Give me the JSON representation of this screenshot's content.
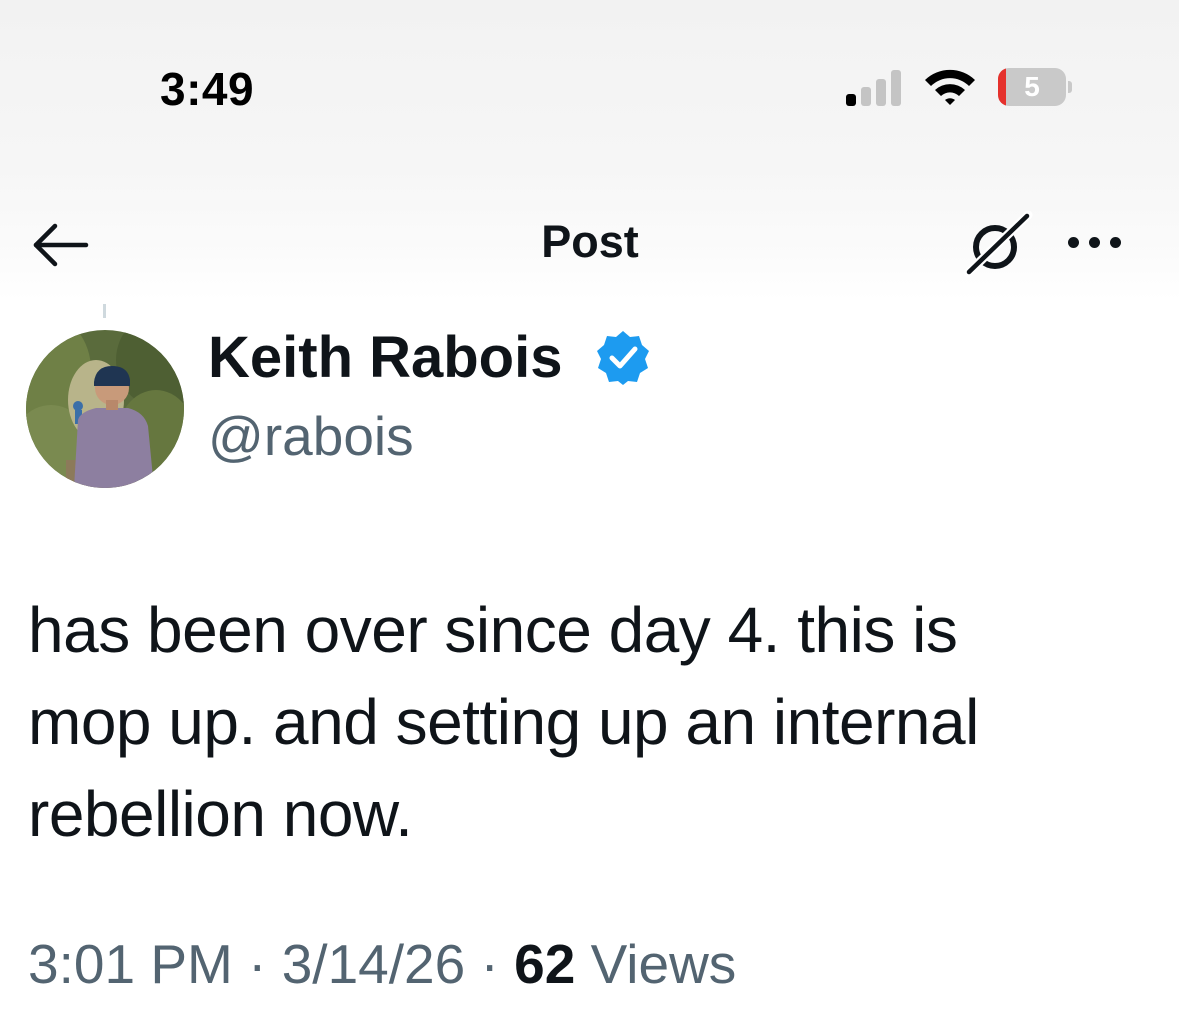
{
  "status_bar": {
    "time": "3:49",
    "battery_level": "5",
    "signal_bars_active": 1,
    "signal_bars_total": 4,
    "battery_fraction": 0.05
  },
  "nav": {
    "title": "Post",
    "back_icon": "arrow-left-icon",
    "grok_icon": "grok-icon",
    "more_icon": "more-horizontal-icon"
  },
  "author": {
    "name": "Keith Rabois",
    "handle": "@rabois",
    "verified": true,
    "verified_icon": "verified-badge-icon"
  },
  "post": {
    "lines": [
      "has been over since day 4.  this is",
      "mop up.  and setting up an internal",
      "rebellion now."
    ]
  },
  "meta": {
    "time": "3:01 PM",
    "separator": "·",
    "date": "3/14/26",
    "views_count": "62",
    "views_label": "Views"
  },
  "colors": {
    "text_primary": "#0f1419",
    "text_secondary": "#536471",
    "verified_blue": "#1d9bf0",
    "battery_low": "#e5312c"
  }
}
